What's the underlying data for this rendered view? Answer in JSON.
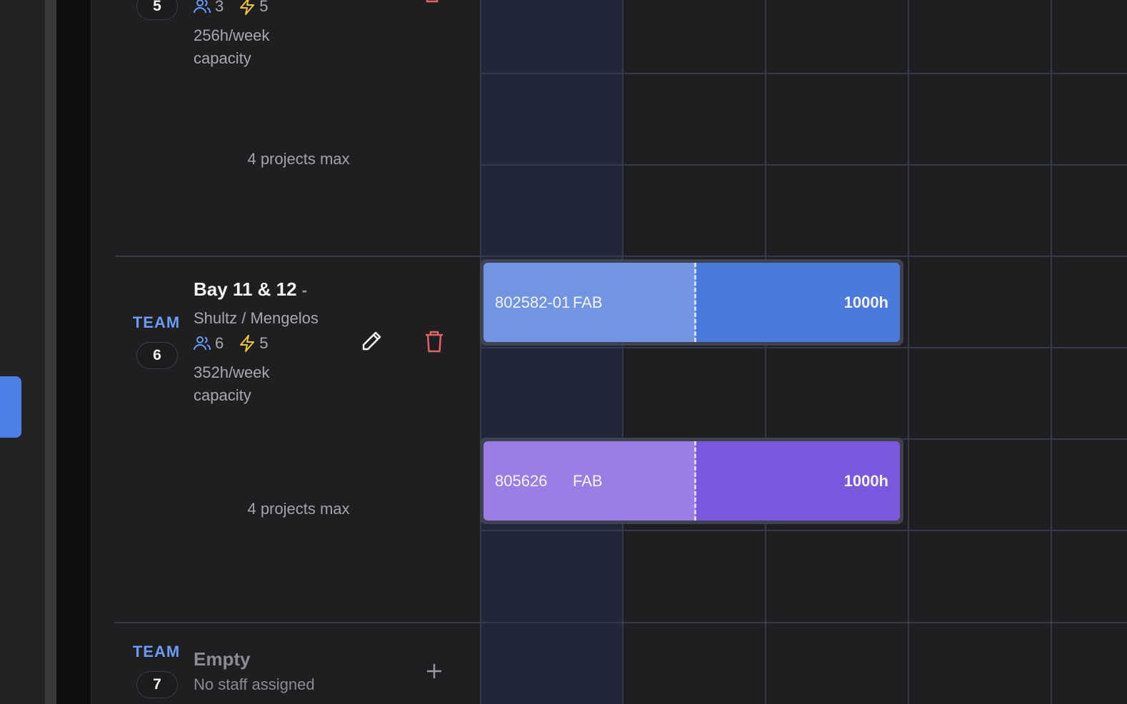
{
  "teams": [
    {
      "label": "",
      "number": "5",
      "members": "3",
      "power": "5",
      "capacity": "256h/week capacity",
      "max_projects": "4 projects max"
    },
    {
      "label": "TEAM",
      "number": "6",
      "name": "Bay 11 & 12",
      "dash": "-",
      "subtitle": "Shultz / Mengelos",
      "members": "6",
      "power": "5",
      "capacity": "352h/week capacity",
      "max_projects": "4 projects max"
    },
    {
      "label": "TEAM",
      "number": "7",
      "name": "Empty",
      "subtitle": "No staff assigned"
    }
  ],
  "bars": [
    {
      "id": "802582-01",
      "phase": "FAB",
      "hours": "1000h",
      "light_color": "#7295e3",
      "dark_color": "#4a7ade"
    },
    {
      "id": "805626",
      "phase": "FAB",
      "hours": "1000h",
      "light_color": "#9a7ee3",
      "dark_color": "#7b58dd"
    }
  ],
  "colors": {
    "accent": "#4d7fe6",
    "team_label": "#6b9bf5",
    "delete": "#e06363",
    "power": "#f0c73a",
    "members": "#6b9bf5"
  }
}
